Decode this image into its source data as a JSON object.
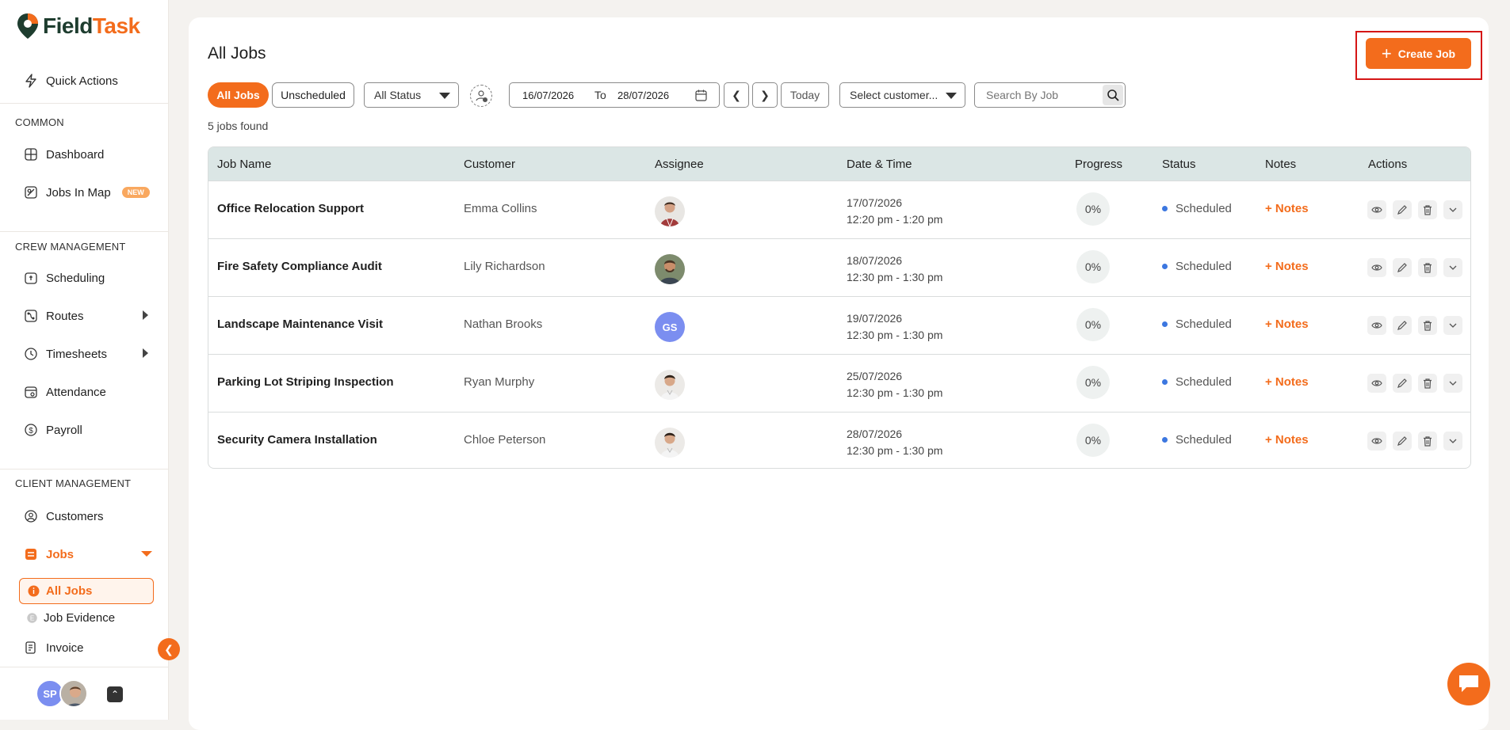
{
  "app": {
    "name_part1": "Field",
    "name_part2": "Task"
  },
  "sidebar": {
    "quick_actions": "Quick Actions",
    "section_common": "COMMON",
    "dashboard": "Dashboard",
    "jobs_in_map": "Jobs In Map",
    "new_badge": "NEW",
    "section_crew": "CREW MANAGEMENT",
    "scheduling": "Scheduling",
    "routes": "Routes",
    "timesheets": "Timesheets",
    "attendance": "Attendance",
    "payroll": "Payroll",
    "section_client": "CLIENT MANAGEMENT",
    "customers": "Customers",
    "jobs": "Jobs",
    "all_jobs": "All Jobs",
    "job_evidence": "Job Evidence",
    "invoice": "Invoice",
    "user_initials": "SP"
  },
  "page": {
    "title": "All Jobs",
    "create_button": "Create Job",
    "jobs_found": "5 jobs found"
  },
  "filters": {
    "tab_all": "All Jobs",
    "tab_unscheduled": "Unscheduled",
    "status_select": "All Status",
    "date_from": "16/07/2026",
    "date_to_label": "To",
    "date_to": "28/07/2026",
    "today": "Today",
    "customer_select": "Select customer...",
    "search_placeholder": "Search By Job"
  },
  "table": {
    "headers": [
      "Job Name",
      "Customer",
      "Assignee",
      "Date & Time",
      "Progress",
      "Status",
      "Notes",
      "Actions"
    ],
    "rows": [
      {
        "job": "Office Relocation Support",
        "customer": "Emma Collins",
        "assignee": "photo",
        "date": "17/07/2026",
        "time": "12:20 pm - 1:20 pm",
        "progress": "0%",
        "status": "Scheduled",
        "notes": "+ Notes"
      },
      {
        "job": "Fire Safety Compliance Audit",
        "customer": "Lily Richardson",
        "assignee": "photo",
        "date": "18/07/2026",
        "time": "12:30 pm - 1:30 pm",
        "progress": "0%",
        "status": "Scheduled",
        "notes": "+ Notes"
      },
      {
        "job": "Landscape Maintenance Visit",
        "customer": "Nathan Brooks",
        "assignee": "GS",
        "date": "19/07/2026",
        "time": "12:30 pm - 1:30 pm",
        "progress": "0%",
        "status": "Scheduled",
        "notes": "+ Notes"
      },
      {
        "job": "Parking Lot Striping Inspection",
        "customer": "Ryan Murphy",
        "assignee": "photo",
        "date": "25/07/2026",
        "time": "12:30 pm - 1:30 pm",
        "progress": "0%",
        "status": "Scheduled",
        "notes": "+ Notes"
      },
      {
        "job": "Security Camera Installation",
        "customer": "Chloe Peterson",
        "assignee": "photo",
        "date": "28/07/2026",
        "time": "12:30 pm - 1:30 pm",
        "progress": "0%",
        "status": "Scheduled",
        "notes": "+ Notes"
      }
    ]
  },
  "colors": {
    "accent": "#f36c1c",
    "header_bg": "#dbe6e5",
    "status_dot": "#3c77e0",
    "avatar_bg": "#7b8ef0"
  }
}
